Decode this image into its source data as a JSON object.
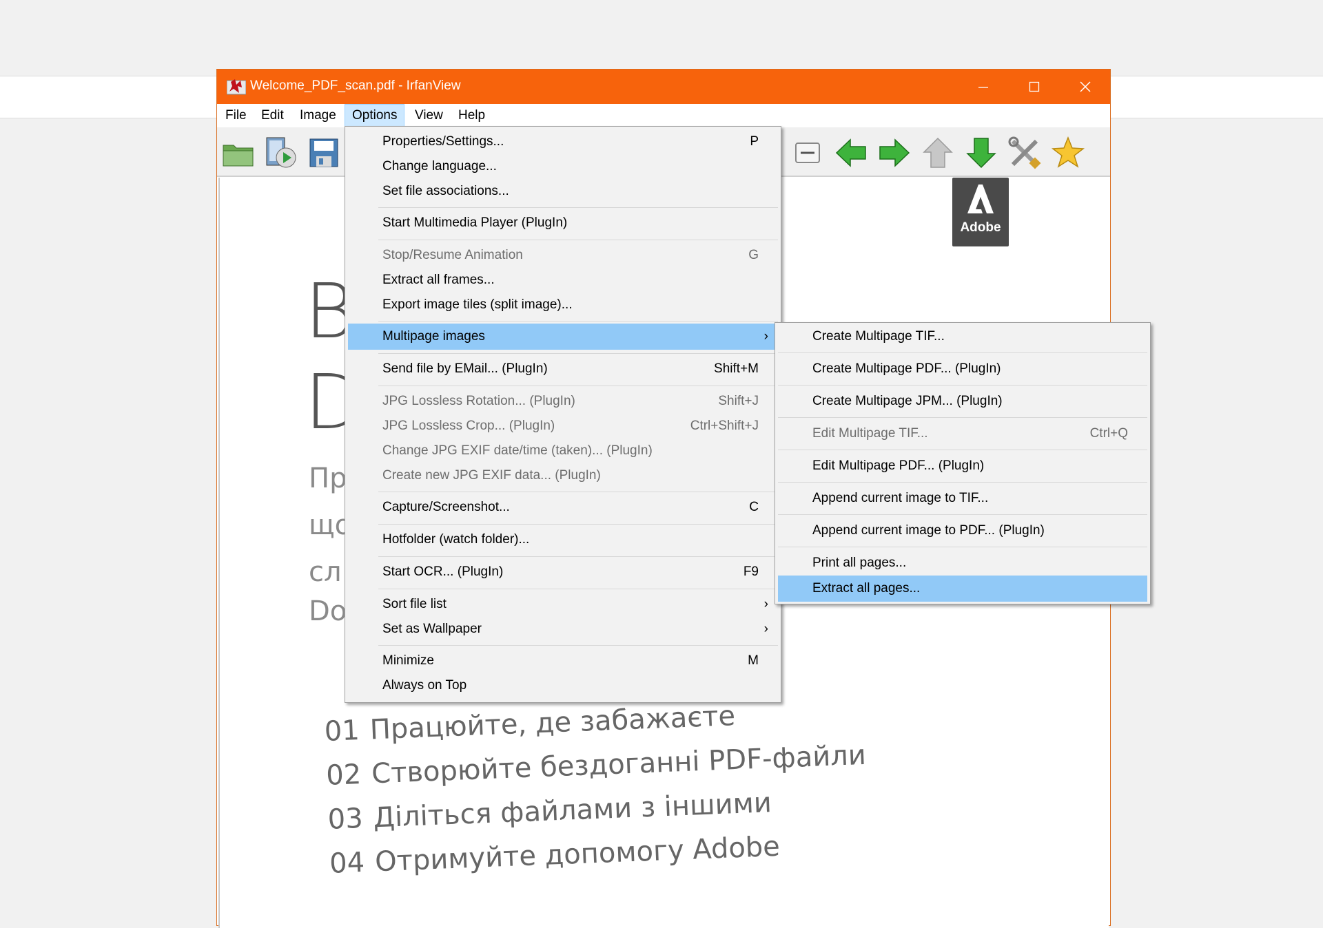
{
  "window": {
    "title": "Welcome_PDF_scan.pdf - IrfanView",
    "accent": "#f7630c"
  },
  "menubar": [
    "File",
    "Edit",
    "Image",
    "Options",
    "View",
    "Help"
  ],
  "toolbar_icons": [
    "open-folder-icon",
    "slideshow-icon",
    "save-icon",
    "zoom-out-icon",
    "previous-arrow-icon",
    "next-arrow-icon",
    "up-arrow-icon",
    "down-arrow-icon",
    "tools-icon",
    "favorite-star-icon"
  ],
  "options_menu": [
    {
      "label": "Properties/Settings...",
      "shortcut": "P"
    },
    {
      "label": "Change language...",
      "shortcut": ""
    },
    {
      "label": "Set file associations...",
      "shortcut": ""
    },
    {
      "label": "Start Multimedia Player (PlugIn)",
      "shortcut": ""
    },
    {
      "label": "Stop/Resume Animation",
      "shortcut": "G"
    },
    {
      "label": "Extract all frames...",
      "shortcut": ""
    },
    {
      "label": "Export image tiles (split image)...",
      "shortcut": ""
    },
    {
      "label": "Multipage images",
      "shortcut": ""
    },
    {
      "label": "Send file by EMail... (PlugIn)",
      "shortcut": "Shift+M"
    },
    {
      "label": "JPG Lossless Rotation... (PlugIn)",
      "shortcut": "Shift+J"
    },
    {
      "label": "JPG Lossless Crop... (PlugIn)",
      "shortcut": "Ctrl+Shift+J"
    },
    {
      "label": "Change JPG EXIF date/time (taken)... (PlugIn)",
      "shortcut": ""
    },
    {
      "label": "Create new JPG EXIF data... (PlugIn)",
      "shortcut": ""
    },
    {
      "label": "Capture/Screenshot...",
      "shortcut": "C"
    },
    {
      "label": "Hotfolder (watch folder)...",
      "shortcut": ""
    },
    {
      "label": "Start OCR... (PlugIn)",
      "shortcut": "F9"
    },
    {
      "label": "Sort file list",
      "shortcut": ""
    },
    {
      "label": "Set as Wallpaper",
      "shortcut": ""
    },
    {
      "label": "Minimize",
      "shortcut": "M"
    },
    {
      "label": "Always on Top",
      "shortcut": ""
    }
  ],
  "multipage_submenu": [
    {
      "label": "Create Multipage TIF...",
      "shortcut": ""
    },
    {
      "label": "Create Multipage PDF... (PlugIn)",
      "shortcut": ""
    },
    {
      "label": "Create Multipage JPM... (PlugIn)",
      "shortcut": ""
    },
    {
      "label": "Edit Multipage TIF...",
      "shortcut": "Ctrl+Q"
    },
    {
      "label": "Edit Multipage PDF... (PlugIn)",
      "shortcut": ""
    },
    {
      "label": "Append current image to TIF...",
      "shortcut": ""
    },
    {
      "label": "Append current image to PDF... (PlugIn)",
      "shortcut": ""
    },
    {
      "label": "Print all pages...",
      "shortcut": ""
    },
    {
      "label": "Extract all pages...",
      "shortcut": ""
    }
  ],
  "document": {
    "heading_letters": [
      "В",
      "D"
    ],
    "partial_lines": [
      "Пр",
      "що",
      "сл",
      "Do"
    ],
    "logo_text": "Adobe",
    "list": [
      {
        "num": "01",
        "text": "Працюйте, де забажаєте"
      },
      {
        "num": "02",
        "text": "Створюйте бездоганні PDF-файли"
      },
      {
        "num": "03",
        "text": "Діліться файлами з іншими"
      },
      {
        "num": "04",
        "text": "Отримуйте допомогу Adobe"
      }
    ]
  }
}
